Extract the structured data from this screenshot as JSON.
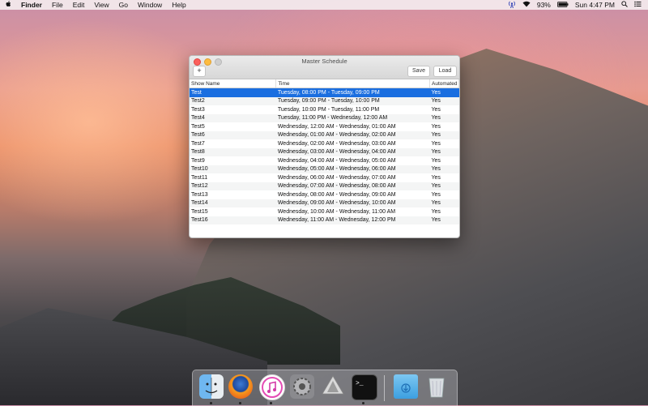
{
  "menubar": {
    "app": "Finder",
    "items": [
      "File",
      "Edit",
      "View",
      "Go",
      "Window",
      "Help"
    ],
    "battery": "93%",
    "clock": "Sun 4:47 PM",
    "icons": [
      "apple-icon",
      "antenna-icon",
      "wifi-icon",
      "battery-icon",
      "search-icon",
      "list-icon"
    ]
  },
  "window": {
    "title": "Master Schedule",
    "add_label": "+",
    "save_label": "Save",
    "load_label": "Load",
    "columns": [
      "Show Name",
      "Time",
      "Automated"
    ],
    "selected_row": 0,
    "rows": [
      [
        "Test",
        "Tuesday, 08:00 PM - Tuesday, 09:00 PM",
        "Yes"
      ],
      [
        "Test2",
        "Tuesday, 09:00 PM - Tuesday, 10:00 PM",
        "Yes"
      ],
      [
        "Test3",
        "Tuesday, 10:00 PM - Tuesday, 11:00 PM",
        "Yes"
      ],
      [
        "Test4",
        "Tuesday, 11:00 PM - Wednesday, 12:00 AM",
        "Yes"
      ],
      [
        "Test5",
        "Wednesday, 12:00 AM - Wednesday, 01:00 AM",
        "Yes"
      ],
      [
        "Test6",
        "Wednesday, 01:00 AM - Wednesday, 02:00 AM",
        "Yes"
      ],
      [
        "Test7",
        "Wednesday, 02:00 AM - Wednesday, 03:00 AM",
        "Yes"
      ],
      [
        "Test8",
        "Wednesday, 03:00 AM - Wednesday, 04:00 AM",
        "Yes"
      ],
      [
        "Test9",
        "Wednesday, 04:00 AM - Wednesday, 05:00 AM",
        "Yes"
      ],
      [
        "Test10",
        "Wednesday, 05:00 AM - Wednesday, 06:00 AM",
        "Yes"
      ],
      [
        "Test11",
        "Wednesday, 06:00 AM - Wednesday, 07:00 AM",
        "Yes"
      ],
      [
        "Test12",
        "Wednesday, 07:00 AM - Wednesday, 08:00 AM",
        "Yes"
      ],
      [
        "Test13",
        "Wednesday, 08:00 AM - Wednesday, 09:00 AM",
        "Yes"
      ],
      [
        "Test14",
        "Wednesday, 09:00 AM - Wednesday, 10:00 AM",
        "Yes"
      ],
      [
        "Test15",
        "Wednesday, 10:00 AM - Wednesday, 11:00 AM",
        "Yes"
      ],
      [
        "Test16",
        "Wednesday, 11:00 AM - Wednesday, 12:00 PM",
        "Yes"
      ]
    ]
  },
  "dock": {
    "apps": [
      "finder-icon",
      "firefox-icon",
      "itunes-icon",
      "system-preferences-icon",
      "xcode-icon",
      "terminal-icon",
      "downloads-folder-icon",
      "trash-icon"
    ],
    "running": [
      "finder-icon",
      "firefox-icon",
      "itunes-icon",
      "terminal-icon"
    ]
  },
  "colors": {
    "selection": "#1a6ee0",
    "close": "#fc605c",
    "minimize": "#fdbc40"
  }
}
